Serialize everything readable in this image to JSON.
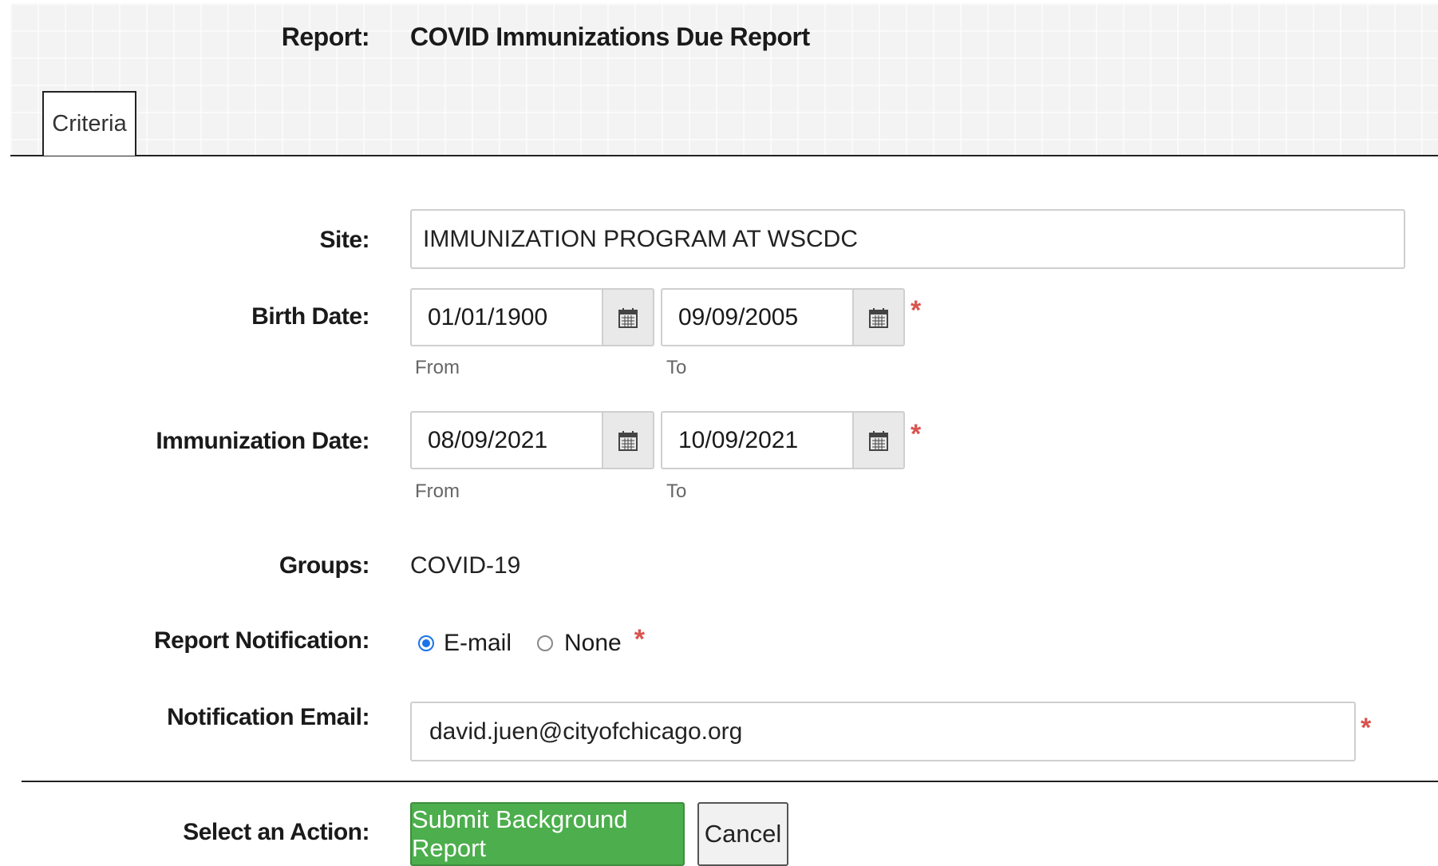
{
  "header": {
    "report_label": "Report:",
    "report_title": "COVID Immunizations Due Report"
  },
  "tabs": [
    {
      "label": "Criteria",
      "active": true
    }
  ],
  "form": {
    "site": {
      "label": "Site:",
      "value": "IMMUNIZATION PROGRAM AT WSCDC"
    },
    "birth_date": {
      "label": "Birth Date:",
      "from_value": "01/01/1900",
      "to_value": "09/09/2005",
      "from_caption": "From",
      "to_caption": "To",
      "required": "*"
    },
    "immunization_date": {
      "label": "Immunization Date:",
      "from_value": "08/09/2021",
      "to_value": "10/09/2021",
      "from_caption": "From",
      "to_caption": "To",
      "required": "*"
    },
    "groups": {
      "label": "Groups:",
      "value": "COVID-19"
    },
    "report_notification": {
      "label": "Report Notification:",
      "options": [
        {
          "label": "E-mail",
          "selected": true
        },
        {
          "label": "None",
          "selected": false
        }
      ],
      "required": "*"
    },
    "notification_email": {
      "label": "Notification Email:",
      "value": "david.juen@cityofchicago.org",
      "required": "*"
    }
  },
  "actions": {
    "label": "Select an Action:",
    "submit_label": "Submit Background Report",
    "cancel_label": "Cancel"
  },
  "icons": {
    "calendar": "calendar-icon"
  },
  "colors": {
    "submit_bg": "#4cae4c",
    "required": "#d9534f",
    "radio_selected": "#1a73e8"
  }
}
